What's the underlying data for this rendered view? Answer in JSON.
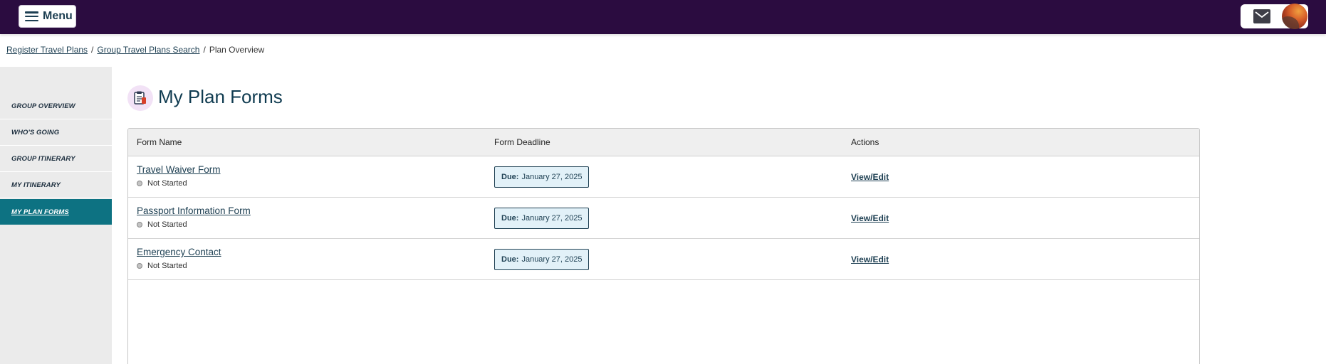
{
  "header": {
    "menu_label": "Menu",
    "icons": {
      "menu": "hamburger-icon",
      "mail": "mail-icon",
      "avatar": "user-avatar"
    }
  },
  "breadcrumb": {
    "items": [
      "Register Travel Plans",
      "Group Travel Plans Search"
    ],
    "separator": "/",
    "current": "Plan Overview"
  },
  "sidebar": {
    "items": [
      {
        "label": "Group Overview",
        "active": false
      },
      {
        "label": "Who's Going",
        "active": false
      },
      {
        "label": "Group Itinerary",
        "active": false
      },
      {
        "label": "My Itinerary",
        "active": false
      },
      {
        "label": "My Plan Forms",
        "active": true
      }
    ]
  },
  "main": {
    "title": "My Plan Forms",
    "title_icon": "clipboard-form-icon",
    "table": {
      "columns": [
        "Form Name",
        "Form Deadline",
        "Actions"
      ],
      "rows": [
        {
          "name": "Travel Waiver Form",
          "status": "Not Started",
          "due_label": "Due:",
          "due_date": "January 27, 2025",
          "action": "View/Edit"
        },
        {
          "name": "Passport Information Form",
          "status": "Not Started",
          "due_label": "Due:",
          "due_date": "January 27, 2025",
          "action": "View/Edit"
        },
        {
          "name": "Emergency Contact",
          "status": "Not Started",
          "due_label": "Due:",
          "due_date": "January 27, 2025",
          "action": "View/Edit"
        }
      ]
    }
  },
  "colors": {
    "topbar": "#2b0c40",
    "accent_teal": "#0d7282",
    "text_dark": "#1d3f52",
    "due_bg": "#e2f1f8"
  }
}
